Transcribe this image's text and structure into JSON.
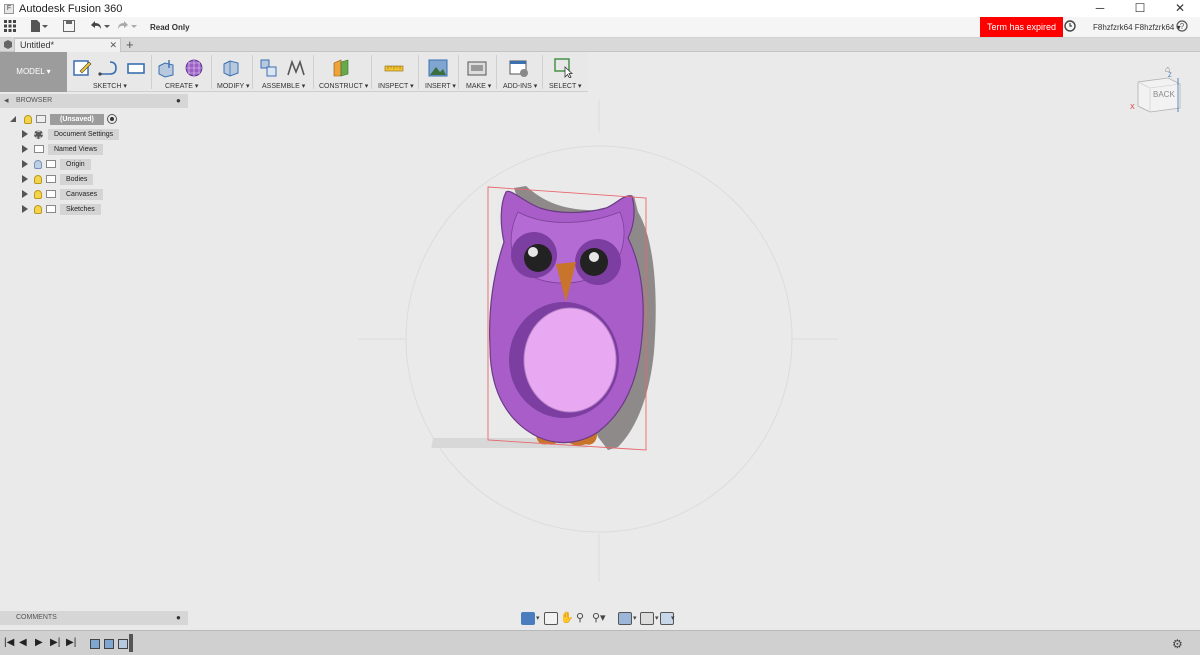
{
  "app": {
    "title": "Autodesk Fusion 360"
  },
  "qat": {
    "read_only": "Read Only",
    "term_expired": "Term has expired",
    "user_name": "F8hzfzrk64 F8hzfzrk64"
  },
  "document": {
    "tab_title": "Untitled*"
  },
  "toolbar": {
    "workspace": "MODEL",
    "groups": [
      {
        "label": "SKETCH"
      },
      {
        "label": "CREATE"
      },
      {
        "label": "MODIFY"
      },
      {
        "label": "ASSEMBLE"
      },
      {
        "label": "CONSTRUCT"
      },
      {
        "label": "INSPECT"
      },
      {
        "label": "INSERT"
      },
      {
        "label": "MAKE"
      },
      {
        "label": "ADD-INS"
      },
      {
        "label": "SELECT"
      }
    ]
  },
  "browser": {
    "title": "BROWSER",
    "root": "(Unsaved)",
    "items": [
      {
        "label": "Document Settings"
      },
      {
        "label": "Named Views"
      },
      {
        "label": "Origin"
      },
      {
        "label": "Bodies"
      },
      {
        "label": "Canvases"
      },
      {
        "label": "Sketches"
      }
    ]
  },
  "comments": {
    "title": "COMMENTS"
  },
  "viewcube": {
    "face": "BACK",
    "axis_x": "X",
    "axis_z": "Z"
  },
  "colors": {
    "term_banner": "#ff0000",
    "owl_body": "#a85dc9",
    "owl_belly": "#e8a8f2",
    "owl_beak": "#c9742b",
    "owl_edge": "#8f8a8a",
    "selection_box": "#e8686c"
  }
}
